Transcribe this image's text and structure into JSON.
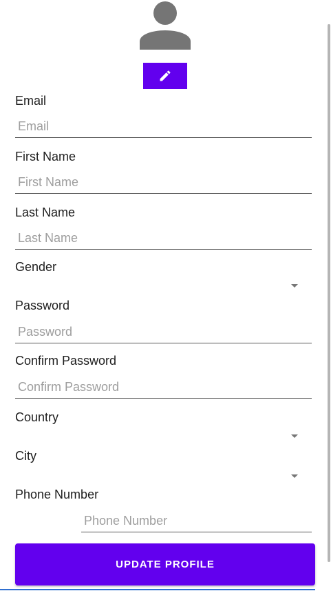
{
  "profile": {
    "avatar_icon": "person-icon",
    "edit_icon": "pencil-icon"
  },
  "form": {
    "email": {
      "label": "Email",
      "placeholder": "Email"
    },
    "first_name": {
      "label": "First Name",
      "placeholder": "First Name"
    },
    "last_name": {
      "label": "Last Name",
      "placeholder": "Last Name"
    },
    "gender": {
      "label": "Gender"
    },
    "password": {
      "label": "Password",
      "placeholder": "Password"
    },
    "confirm_password": {
      "label": "Confirm Password",
      "placeholder": "Confirm Password"
    },
    "country": {
      "label": "Country"
    },
    "city": {
      "label": "City"
    },
    "phone_number": {
      "label": "Phone Number",
      "placeholder": "Phone Number"
    }
  },
  "actions": {
    "update_label": "UPDATE PROFILE"
  },
  "colors": {
    "accent": "#6200ee",
    "avatar": "#757575",
    "underline": "#555555",
    "placeholder": "#9e9e9e"
  }
}
